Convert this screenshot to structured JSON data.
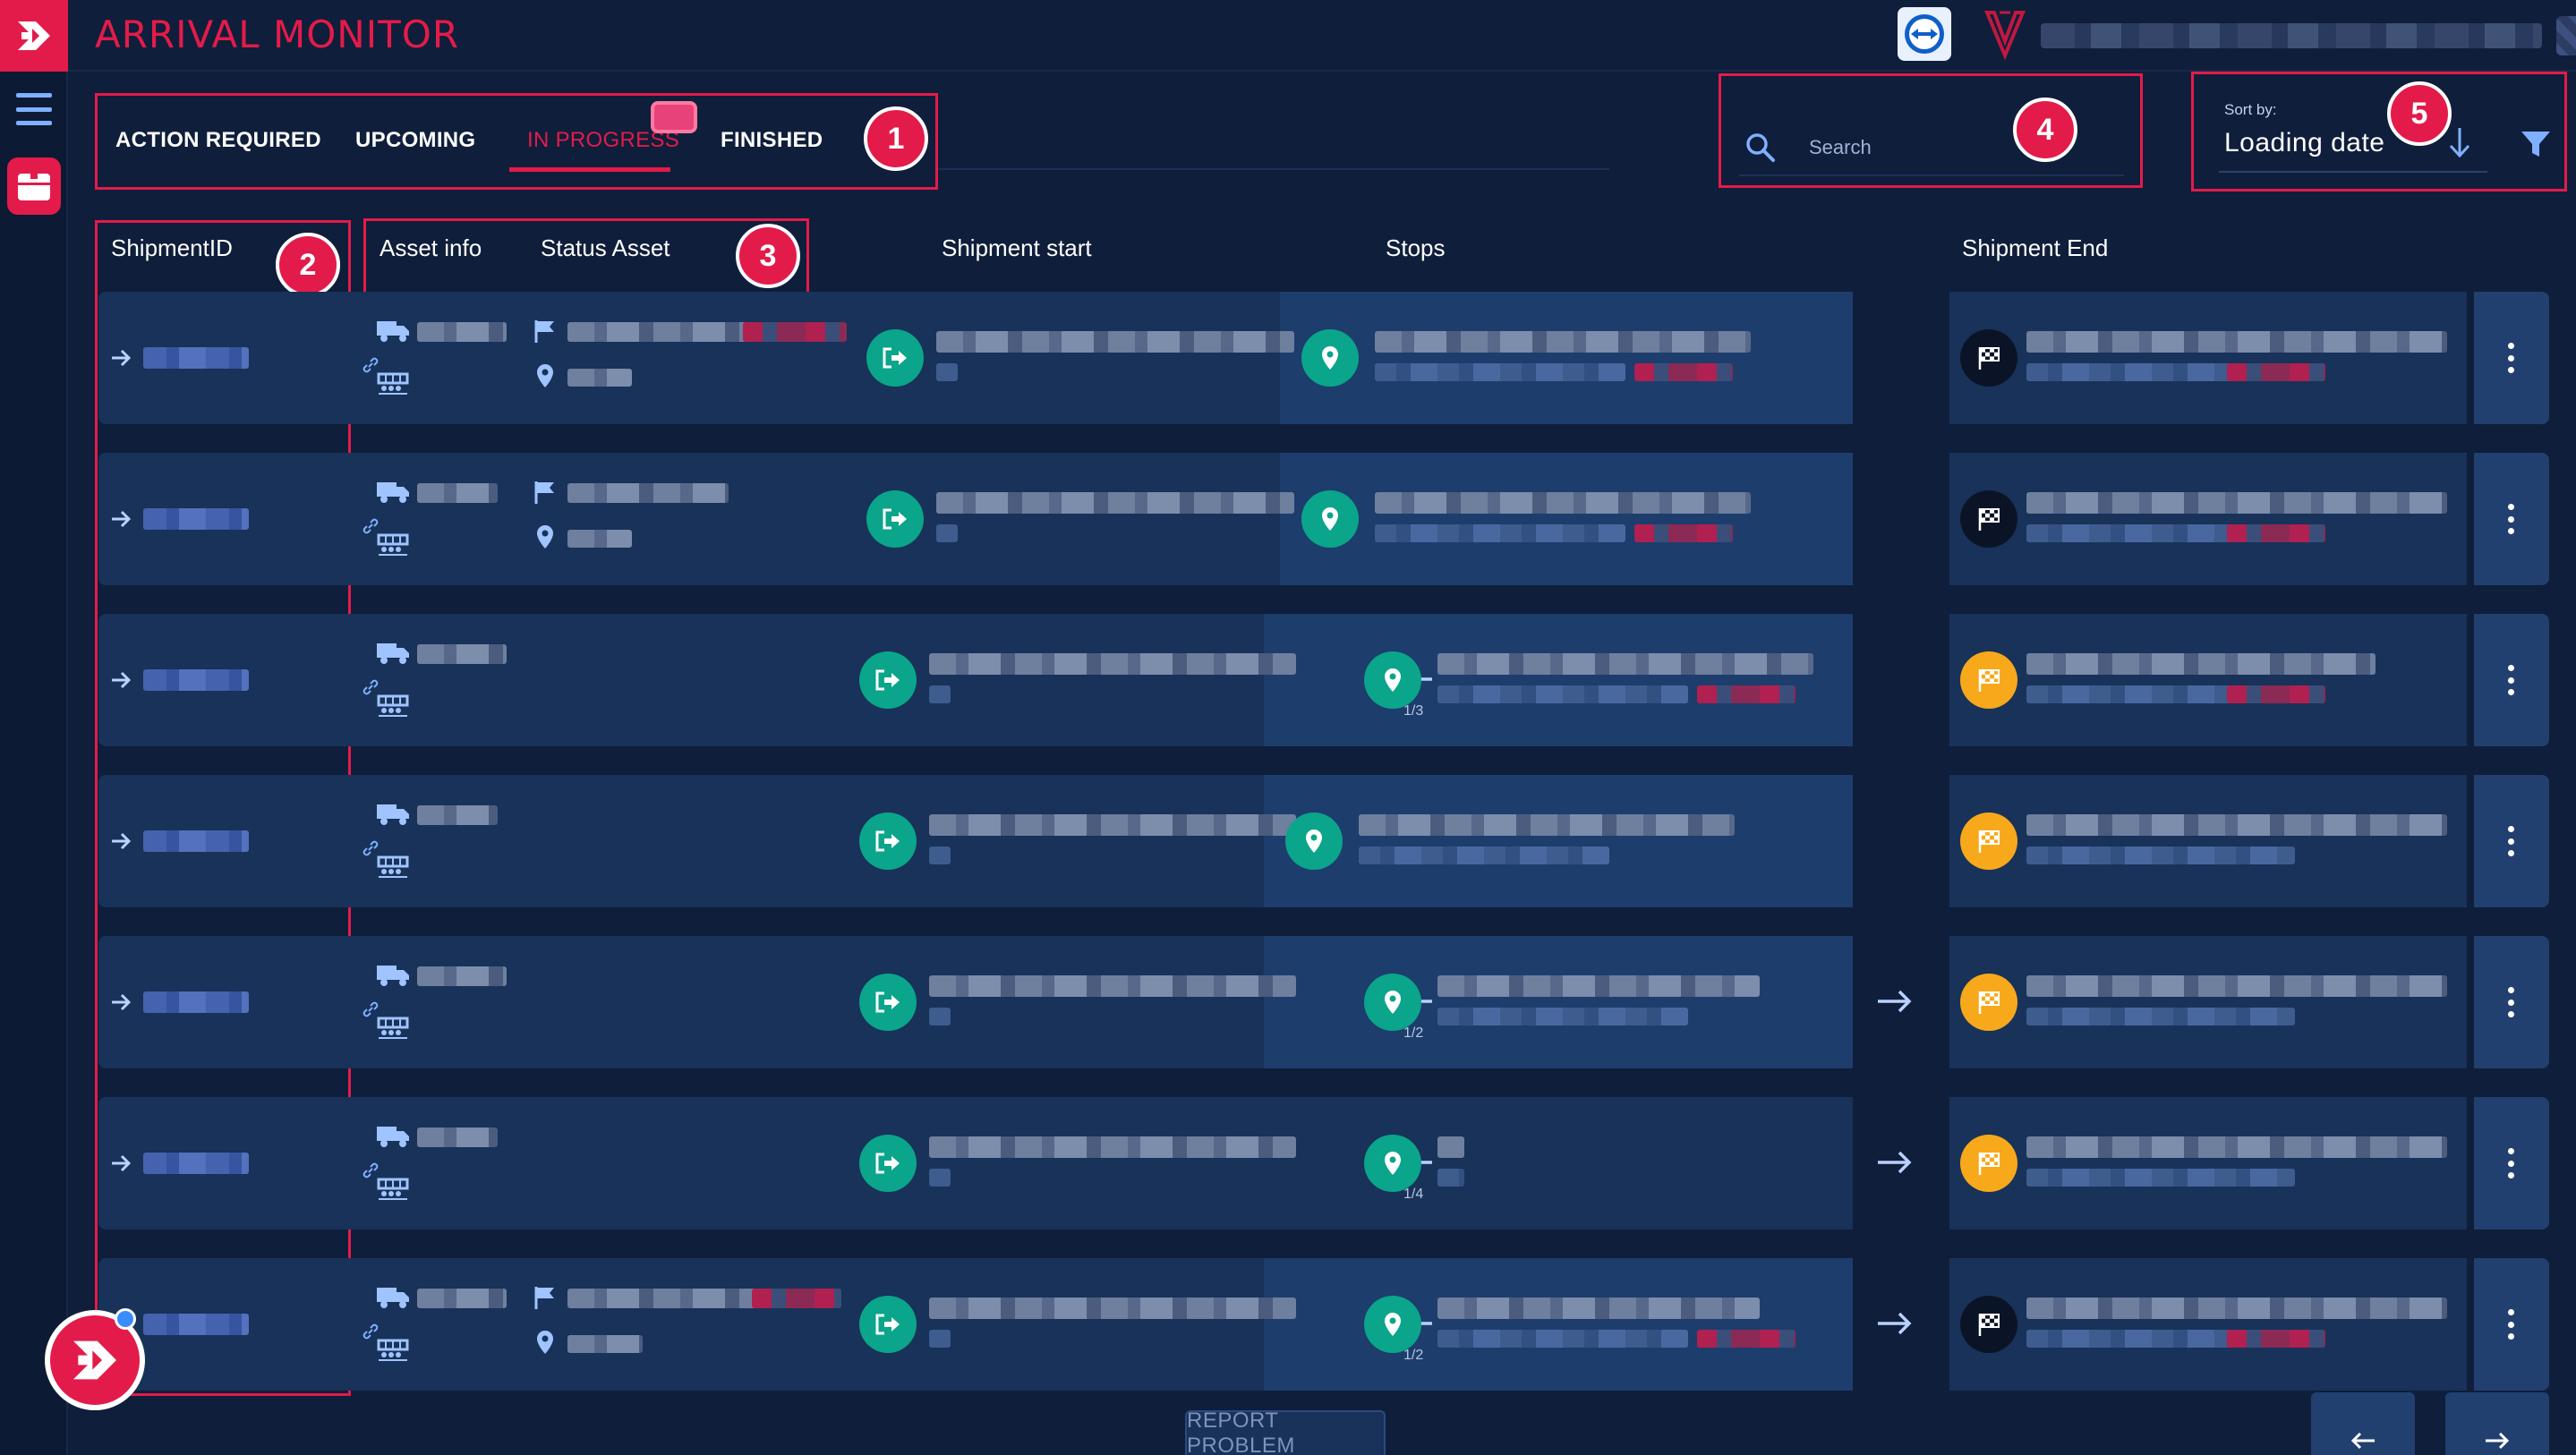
{
  "header": {
    "title": "ARRIVAL MONITOR"
  },
  "tabs": [
    {
      "label": "ACTION REQUIRED"
    },
    {
      "label": "UPCOMING"
    },
    {
      "label": "IN PROGRESS"
    },
    {
      "label": "FINISHED"
    }
  ],
  "search": {
    "placeholder": "Search"
  },
  "sort": {
    "label": "Sort by:",
    "value": "Loading date"
  },
  "columns": {
    "shipment_id": "ShipmentID",
    "asset_info": "Asset info",
    "status_asset": "Status Asset",
    "shipment_start": "Shipment start",
    "stops": "Stops",
    "shipment_end": "Shipment End"
  },
  "annotations": [
    "1",
    "2",
    "3",
    "4",
    "5"
  ],
  "rows": [
    {
      "stops_counter": ""
    },
    {
      "stops_counter": ""
    },
    {
      "stops_counter": "1/3"
    },
    {
      "stops_counter": ""
    },
    {
      "stops_counter": "1/2"
    },
    {
      "stops_counter": "1/4"
    },
    {
      "stops_counter": "1/2"
    }
  ],
  "footer": {
    "report_label": "REPORT PROBLEM"
  },
  "colors": {
    "brand": "#e31b4a",
    "background": "#0f1e3a",
    "row": "#183259",
    "teal": "#0aa58a",
    "gold": "#f7a91b"
  },
  "icons": [
    "menu-icon",
    "box-icon",
    "search-icon",
    "filter-icon",
    "sort-arrow-icon",
    "truck-icon",
    "link-icon",
    "rail-icon",
    "flag-icon",
    "location-pin-icon",
    "departure-icon",
    "checkered-flag-icon",
    "arrow-left-icon",
    "arrow-right-icon",
    "kebab-icon"
  ]
}
